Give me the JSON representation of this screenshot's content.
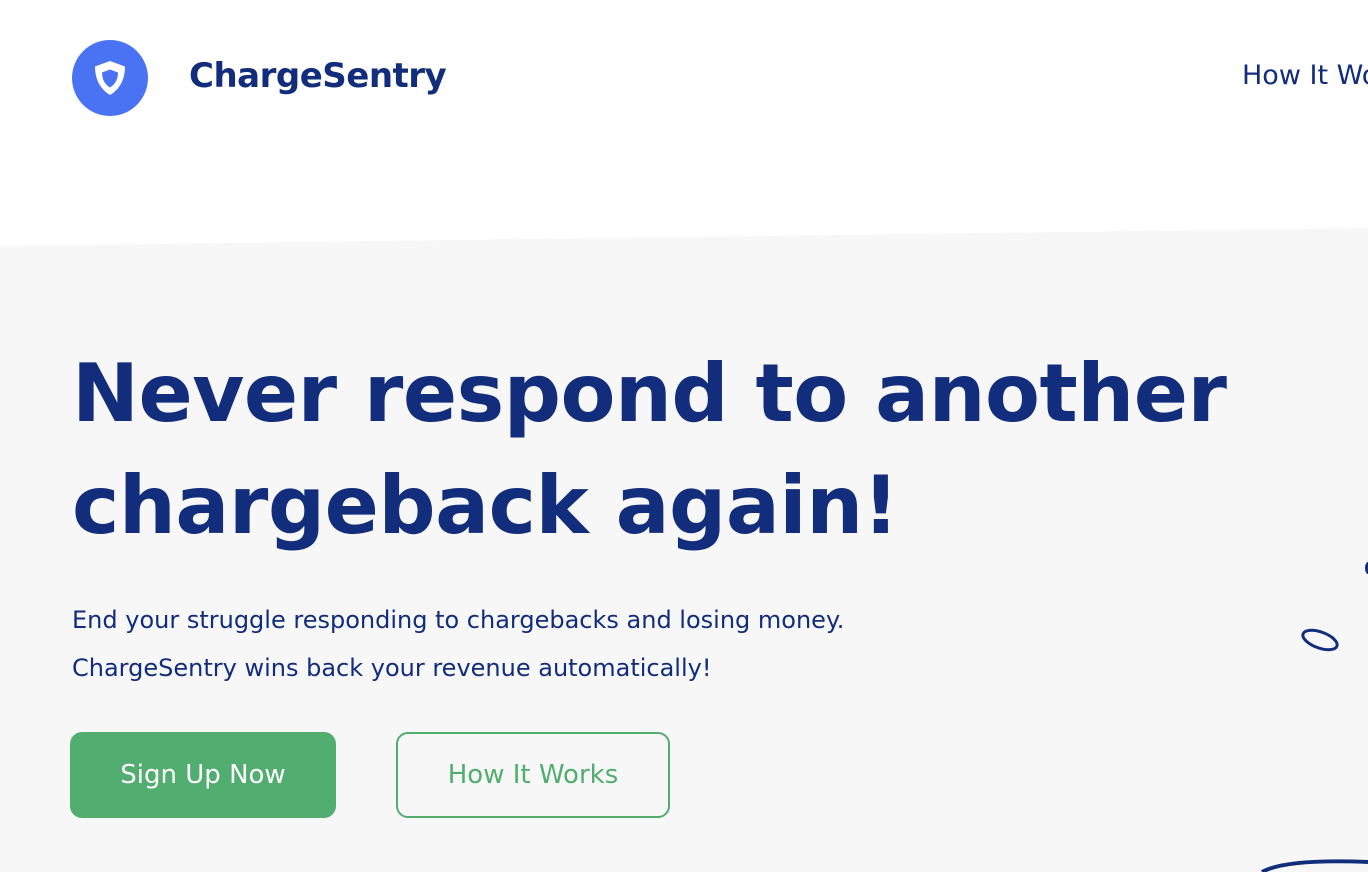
{
  "header": {
    "brand": "ChargeSentry",
    "logo_icon": "shield-icon",
    "nav_link": "How It Works"
  },
  "hero": {
    "title_line1": "Never respond to another",
    "title_line2": "chargeback again!",
    "subtitle_line1": "End your struggle responding to chargebacks and losing money.",
    "subtitle_line2": "ChargeSentry wins back your revenue automatically!",
    "primary_button": "Sign Up Now",
    "secondary_button": "How It Works"
  },
  "colors": {
    "brand_navy": "#112d7c",
    "logo_blue": "#4a73f3",
    "accent_green": "#52ad70",
    "hero_background": "#f7f7f7"
  }
}
